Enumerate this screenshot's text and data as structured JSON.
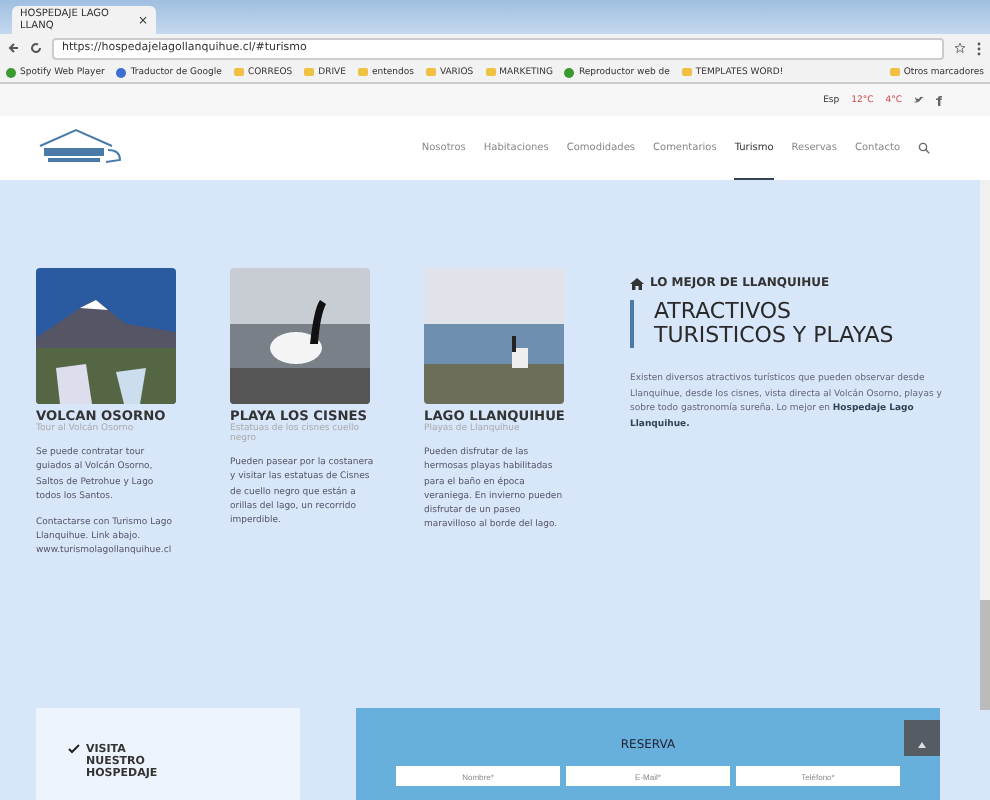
{
  "browser": {
    "tab": {
      "title": "HOSPEDAJE LAGO LLANQ",
      "close": "×"
    },
    "url": "https://hospedajelagollanquihue.cl/#turismo",
    "bookmarks": [
      {
        "label": "Spotify Web Player",
        "kind": "green"
      },
      {
        "label": "Traductor de Google",
        "kind": "blue"
      },
      {
        "label": "CORREOS",
        "kind": "folder"
      },
      {
        "label": "DRIVE",
        "kind": "folder"
      },
      {
        "label": "entendos",
        "kind": "folder"
      },
      {
        "label": "VARIOS",
        "kind": "folder"
      },
      {
        "label": "MARKETING",
        "kind": "folder"
      },
      {
        "label": "Reproductor web de",
        "kind": "green"
      },
      {
        "label": "TEMPLATES WORD!",
        "kind": "folder"
      }
    ],
    "other_bookmarks": "Otros marcadores"
  },
  "topbar": {
    "language": "Esp",
    "weather": [
      {
        "temp": "12°C"
      },
      {
        "temp": "4°C"
      }
    ]
  },
  "nav": [
    {
      "label": "Nosotros",
      "selected": false
    },
    {
      "label": "Habitaciones",
      "selected": false
    },
    {
      "label": "Comodidades",
      "selected": false
    },
    {
      "label": "Comentarios",
      "selected": false
    },
    {
      "label": "Turismo",
      "selected": true
    },
    {
      "label": "Reservas",
      "selected": false
    },
    {
      "label": "Contacto",
      "selected": false
    }
  ],
  "cards": [
    {
      "title": "VOLCAN OSORNO",
      "subtitle": "Tour al Volcán Osorno",
      "kind": "volcano",
      "paragraphs": [
        "Se puede contratar tour guiados al Volcán Osorno, Saltos de Petrohue y Lago todos los Santos.",
        "Contactarse con Turismo Lago Llanquihue. Link abajo. www.turismolagollanquihue.cl"
      ]
    },
    {
      "title": "PLAYA LOS CISNES",
      "subtitle": "Estatuas de los cisnes cuello negro",
      "kind": "swan",
      "paragraphs": [
        "Pueden pasear por la costanera y visitar las estatuas de Cisnes de cuello negro que están a orillas del lago, un recorrido imperdible."
      ]
    },
    {
      "title": "LAGO LLANQUIHUE",
      "subtitle": "Playas de Llanquihue",
      "kind": "lake",
      "paragraphs": [
        "Pueden disfrutar de las hermosas playas habilitadas para el baño en época veraniega. En invierno pueden disfrutar de un paseo maravilloso al borde del lago."
      ]
    }
  ],
  "intro": {
    "kicker": "LO MEJOR DE LLANQUIHUE",
    "heading": "ATRACTIVOS TURISTICOS Y PLAYAS",
    "text": "Existen diversos atractivos turísticos que pueden observar desde Llanquihue, desde los cisnes, vista directa al Volcán Osorno, playas y sobre todo gastronomía sureña. Lo mejor en **Hospedaje Lago Llanquihue.**"
  },
  "visit": {
    "title": "VISITA NUESTRO HOSPEDAJE"
  },
  "reserva": {
    "title": "RESERVA",
    "fields": [
      {
        "placeholder": "Nombre*"
      },
      {
        "placeholder": "E-Mail*"
      },
      {
        "placeholder": "Teléfono*"
      }
    ]
  }
}
